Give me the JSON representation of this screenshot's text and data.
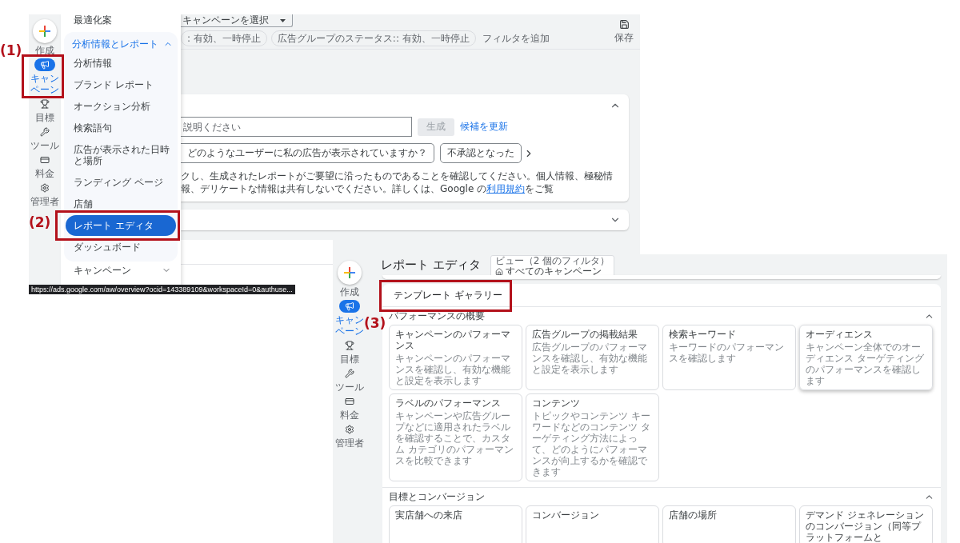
{
  "annotations": [
    {
      "label": "(1)"
    },
    {
      "label": "(2)"
    },
    {
      "label": "(3)"
    }
  ],
  "top_screenshot": {
    "rail": {
      "create_label": "作成",
      "items": [
        {
          "label": "キャンペーン",
          "selected": true
        },
        {
          "label": "目標",
          "selected": false
        },
        {
          "label": "ツール",
          "selected": false
        },
        {
          "label": "料金",
          "selected": false
        },
        {
          "label": "管理者",
          "selected": false
        }
      ]
    },
    "menu": {
      "top_item": "最適化案",
      "group": {
        "label": "分析情報とレポート",
        "expanded": true,
        "items": [
          {
            "label": "分析情報",
            "selected": false
          },
          {
            "label": "ブランド レポート",
            "selected": false
          },
          {
            "label": "オークション分析",
            "selected": false
          },
          {
            "label": "検索語句",
            "selected": false
          },
          {
            "label": "広告が表示された日時と場所",
            "selected": false
          },
          {
            "label": "ランディング ページ",
            "selected": false
          },
          {
            "label": "店舗",
            "selected": false
          },
          {
            "label": "レポート エディタ",
            "selected": true
          },
          {
            "label": "ダッシュボード",
            "selected": false
          }
        ]
      },
      "next_item": "キャンペーン"
    },
    "toolbar": {
      "campaign_select": "キャンペーンを選択",
      "filters": [
        ": 有効、一時停止",
        "広告グループのステータス:: 有効、一時停止"
      ],
      "add_filter": "フィルタを追加",
      "save_label": "保存"
    },
    "generator_card": {
      "expanded": true,
      "input_placeholder": "説明ください",
      "generate_button": "生成",
      "generate_disabled": true,
      "refresh_link": "候補を更新",
      "suggestions": [
        "どのようなユーザーに私の広告が表示されていますか？",
        "不承認となった"
      ],
      "disclaimer": "クし、生成されたレポートがご要望に沿ったものであることを確認してください。個人情報、極秘情報、デリケートな情報は共有しないでください。詳しくは、Google の",
      "disclaimer_link": "利用規約",
      "disclaimer_end": "をご覧"
    },
    "second_card": {
      "expanded": false
    },
    "status_url": "https://ads.google.com/aw/overview?ocid=143389109&workspaceId=0&authuse..."
  },
  "bottom_screenshot": {
    "rail": {
      "create_label": "作成",
      "items": [
        {
          "label": "キャンペーン",
          "selected": true
        },
        {
          "label": "目標",
          "selected": false
        },
        {
          "label": "ツール",
          "selected": false
        },
        {
          "label": "料金",
          "selected": false
        },
        {
          "label": "管理者",
          "selected": false
        }
      ]
    },
    "title": "レポート エディタ",
    "view": {
      "label": "ビュー（2 個のフィルタ）",
      "value": "すべてのキャンペーン"
    },
    "gallery": {
      "title": "テンプレート ギャラリー",
      "sections": [
        {
          "title": "パフォーマンスの概要",
          "expanded": true,
          "templates": [
            {
              "title": "キャンペーンのパフォーマンス",
              "description": "キャンペーンのパフォーマンスを確認し、有効な機能と設定を表示します",
              "raised": false
            },
            {
              "title": "広告グループの掲載結果",
              "description": "広告グループのパフォーマンスを確認し、有効な機能と設定を表示します",
              "raised": false
            },
            {
              "title": "検索キーワード",
              "description": "キーワードのパフォーマンスを確認します",
              "raised": false
            },
            {
              "title": "オーディエンス",
              "description": "キャンペーン全体でのオーディエンス ターゲティングのパフォーマンスを確認します",
              "raised": true
            },
            {
              "title": "ラベルのパフォーマンス",
              "description": "キャンペーンや広告グループなどに適用されたラベルを確認することで、カスタム カテゴリのパフォーマンスを比較できます",
              "raised": false
            },
            {
              "title": "コンテンツ",
              "description": "トピックやコンテンツ キーワードなどのコンテンツ ターゲティング方法によって、どのようにパフォーマンスが向上するかを確認できます",
              "raised": false
            }
          ]
        },
        {
          "title": "目標とコンバージョン",
          "expanded": true,
          "templates": [
            {
              "title": "実店舗への来店",
              "raised": false
            },
            {
              "title": "コンバージョン",
              "raised": false
            },
            {
              "title": "店舗の場所",
              "raised": false
            },
            {
              "title": "デマンド ジェネレーションのコンバージョン（同等プラットフォームと",
              "raised": false
            }
          ]
        }
      ]
    }
  }
}
